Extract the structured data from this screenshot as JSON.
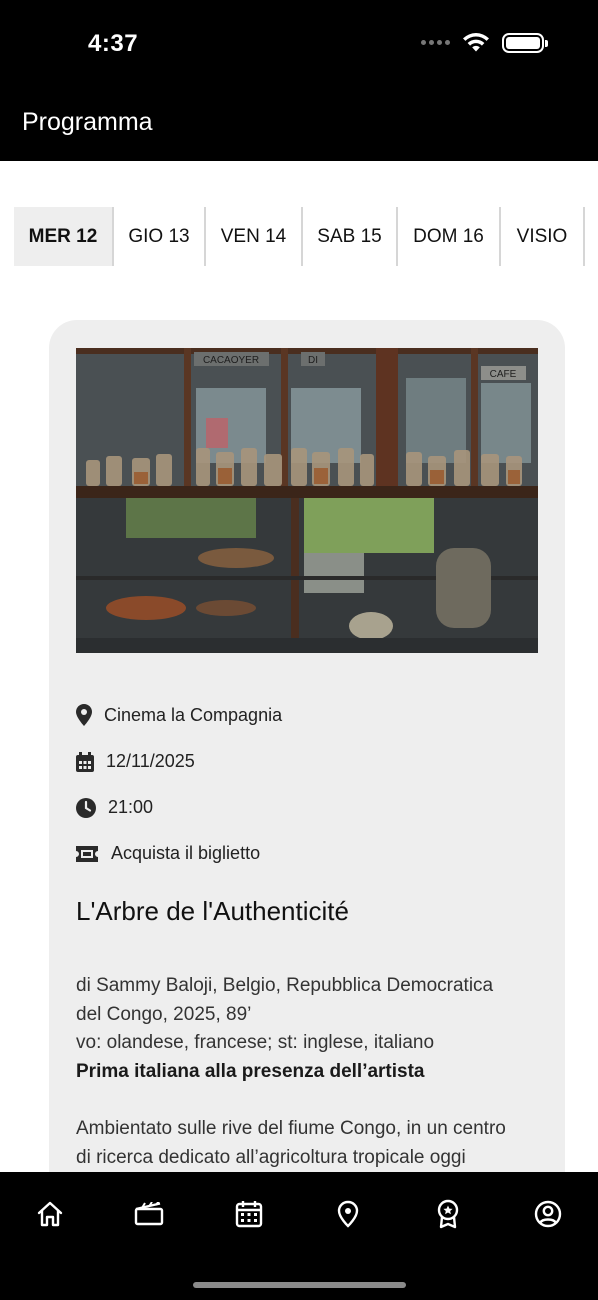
{
  "status_bar": {
    "time": "4:37"
  },
  "header": {
    "title": "Programma"
  },
  "day_tabs": [
    {
      "label": "MER 12",
      "active": true
    },
    {
      "label": "GIO 13",
      "active": false
    },
    {
      "label": "VEN 14",
      "active": false
    },
    {
      "label": "SAB 15",
      "active": false
    },
    {
      "label": "DOM 16",
      "active": false
    },
    {
      "label": "VISIO",
      "active": false
    }
  ],
  "event": {
    "venue": "Cinema la Compagnia",
    "date": "12/11/2025",
    "time": "21:00",
    "ticket_label": "Acquista il biglietto",
    "title": "L'Arbre de l'Authenticité",
    "credits_line1": "di Sammy Baloji, Belgio, Repubblica Democratica",
    "credits_line2": "del Congo, 2025, 89’",
    "languages": "vo: olandese, francese; st: inglese, italiano",
    "premiere_note": "Prima italiana alla presenza dell’artista",
    "synopsis_line1": "Ambientato sulle rive del fiume Congo, in un centro",
    "synopsis_line2": "di ricerca dedicato all’agricoltura tropicale oggi",
    "poster_labels": [
      "CACAOYER",
      "DI",
      "CAFE"
    ]
  },
  "bottom_tabs": [
    {
      "icon": "home-icon"
    },
    {
      "icon": "film-icon"
    },
    {
      "icon": "calendar-icon"
    },
    {
      "icon": "location-pin-icon"
    },
    {
      "icon": "award-icon"
    },
    {
      "icon": "profile-icon"
    }
  ],
  "colors": {
    "header_bg": "#000000",
    "card_bg": "#eeeeee",
    "active_tab_bg": "#eeeeee",
    "tab_divider": "#d6d6d6"
  }
}
